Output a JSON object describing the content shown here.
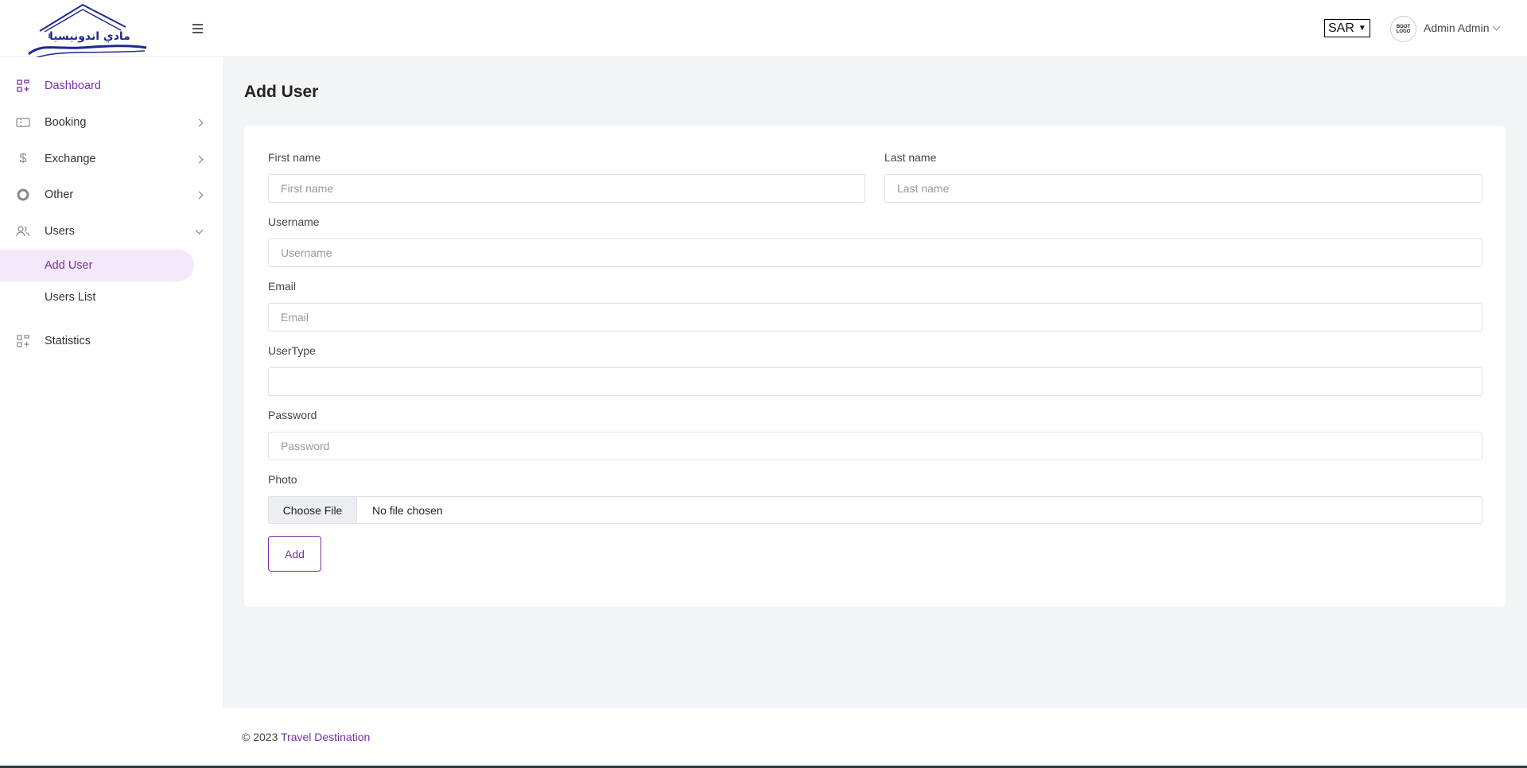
{
  "header": {
    "logo_text": "مادي اندونيسيا",
    "currency": "SAR",
    "avatar_text": "BOOT LOGO",
    "user_name": "Admin Admin"
  },
  "sidebar": {
    "items": [
      {
        "label": "Dashboard",
        "icon": "dashboard-icon",
        "active": true
      },
      {
        "label": "Booking",
        "icon": "ticket-icon",
        "has_submenu": true
      },
      {
        "label": "Exchange",
        "icon": "dollar-icon",
        "has_submenu": true
      },
      {
        "label": "Other",
        "icon": "circle-icon",
        "has_submenu": true
      },
      {
        "label": "Users",
        "icon": "users-icon",
        "has_submenu": true,
        "expanded": true
      },
      {
        "label": "Statistics",
        "icon": "statistics-icon"
      }
    ],
    "users_submenu": [
      {
        "label": "Add User",
        "active": true
      },
      {
        "label": "Users List"
      }
    ]
  },
  "page": {
    "title": "Add User"
  },
  "form": {
    "first_name": {
      "label": "First name",
      "placeholder": "First name",
      "value": ""
    },
    "last_name": {
      "label": "Last name",
      "placeholder": "Last name",
      "value": ""
    },
    "username": {
      "label": "Username",
      "placeholder": "Username",
      "value": ""
    },
    "email": {
      "label": "Email",
      "placeholder": "Email",
      "value": ""
    },
    "usertype": {
      "label": "UserType",
      "value": ""
    },
    "password": {
      "label": "Password",
      "placeholder": "Password",
      "value": ""
    },
    "photo": {
      "label": "Photo",
      "button": "Choose File",
      "status": "No file chosen"
    },
    "submit": "Add"
  },
  "footer": {
    "copyright": "© 2023",
    "link": "Travel Destination"
  },
  "colors": {
    "accent": "#7b2fa6",
    "background": "#f3f4f7",
    "logo": "#1f2a8a"
  }
}
